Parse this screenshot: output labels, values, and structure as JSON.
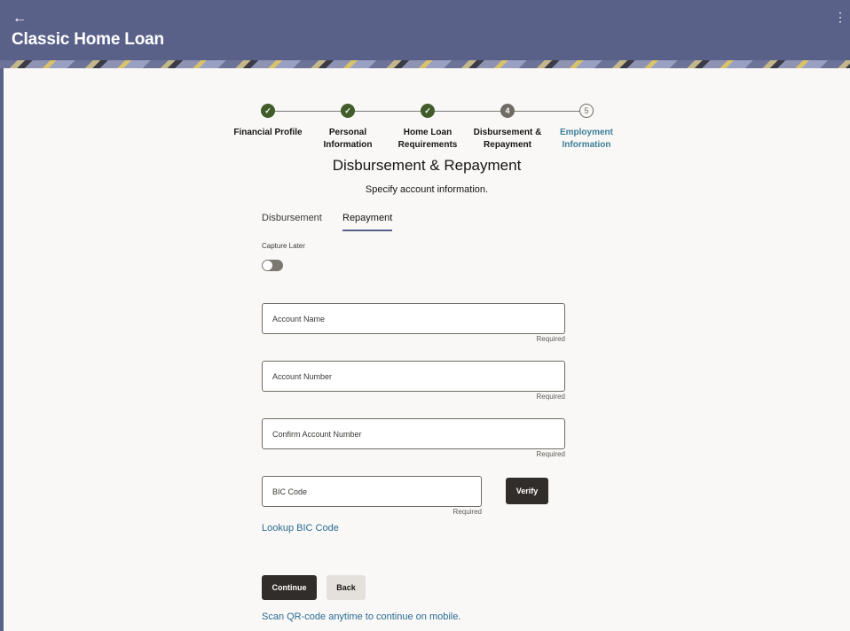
{
  "header": {
    "title": "Classic Home Loan",
    "back_icon": "arrow-left-icon",
    "more_icon": "kebab-menu-icon"
  },
  "stepper": {
    "steps": [
      {
        "number": "1",
        "label_line1": "Financial Profile",
        "label_line2": "",
        "status": "completed"
      },
      {
        "number": "2",
        "label_line1": "Personal",
        "label_line2": "Information",
        "status": "completed"
      },
      {
        "number": "3",
        "label_line1": "Home Loan",
        "label_line2": "Requirements",
        "status": "completed"
      },
      {
        "number": "4",
        "label_line1": "Disbursement &",
        "label_line2": "Repayment",
        "status": "current"
      },
      {
        "number": "5",
        "label_line1": "Employment",
        "label_line2": "Information",
        "status": "upcoming"
      }
    ]
  },
  "page": {
    "title": "Disbursement & Repayment",
    "subtitle": "Specify account information."
  },
  "tabs": [
    {
      "label": "Disbursement",
      "active": false
    },
    {
      "label": "Repayment",
      "active": true
    }
  ],
  "capture_later": {
    "label": "Capture Later",
    "on": false
  },
  "form": {
    "account_name": {
      "placeholder": "Account Name",
      "value": "",
      "hint": "Required"
    },
    "account_number": {
      "placeholder": "Account Number",
      "value": "",
      "hint": "Required"
    },
    "confirm_account_number": {
      "placeholder": "Confirm Account Number",
      "value": "",
      "hint": "Required"
    },
    "bic_code": {
      "placeholder": "BIC Code",
      "value": "",
      "hint": "Required"
    },
    "verify_label": "Verify",
    "lookup_label": "Lookup BIC Code"
  },
  "actions": {
    "continue_label": "Continue",
    "back_label": "Back",
    "qr_text": "Scan QR-code anytime to continue on mobile."
  },
  "colors": {
    "header_bg": "#5a6189",
    "completed": "#3f5c2a",
    "link": "#2a6b93",
    "primary_button": "#312d2a"
  }
}
